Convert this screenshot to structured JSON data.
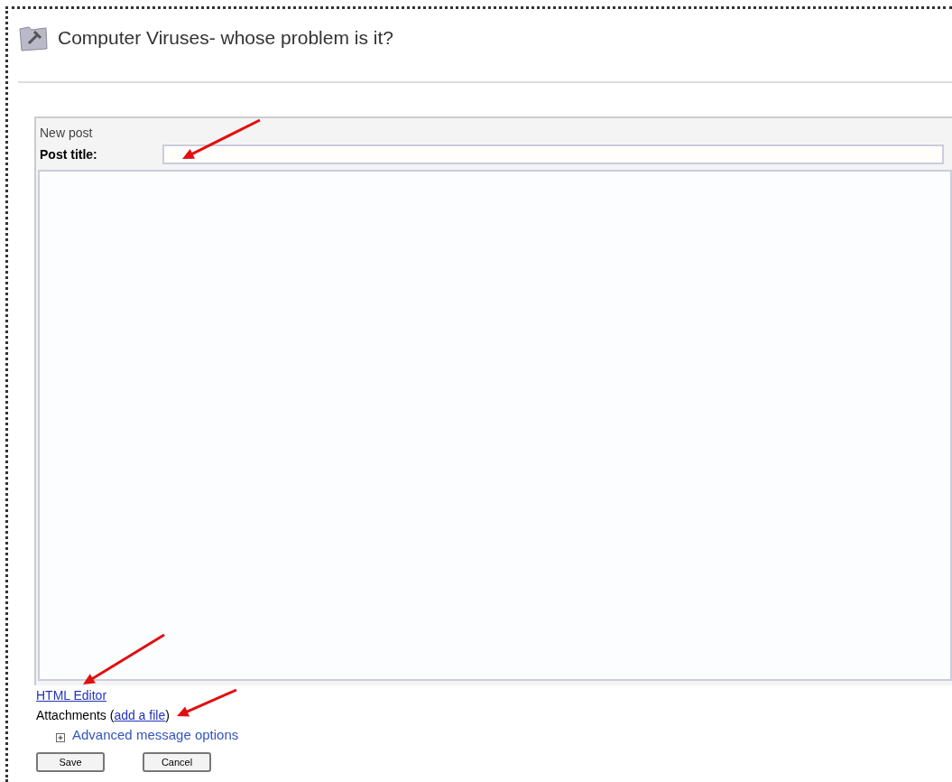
{
  "page": {
    "title": "Computer Viruses- whose problem is it?"
  },
  "form": {
    "heading": "New post",
    "title_label": "Post title:",
    "editor_link": "HTML Editor",
    "attachments_label": "Attachments (",
    "attachments_link": "add a file",
    "attachments_close": ")",
    "advanced": {
      "label": "Advanced message options"
    }
  },
  "buttons": [
    "Save",
    "Cancel"
  ]
}
